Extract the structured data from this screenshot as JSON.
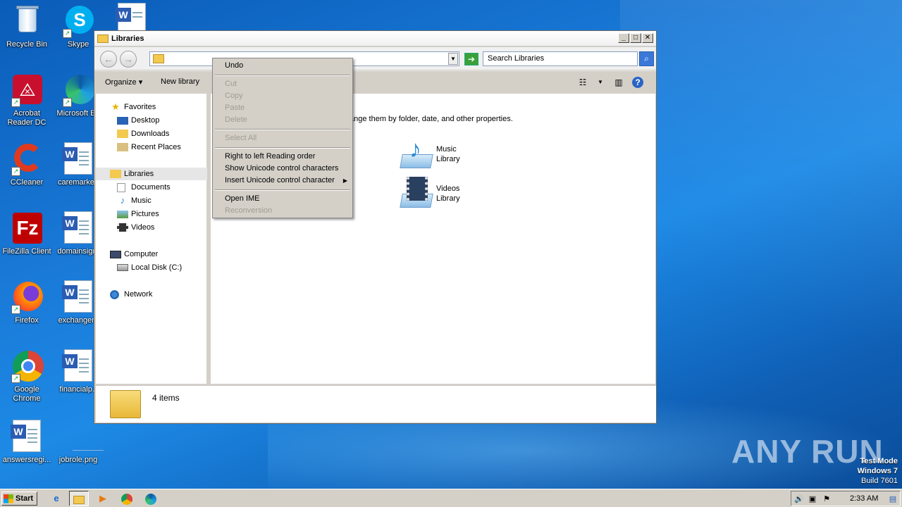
{
  "desktop": {
    "icons": [
      {
        "label": "Recycle Bin"
      },
      {
        "label": "Skype"
      },
      {
        "label": "Acrobat Reader DC"
      },
      {
        "label": "Microsoft Ed"
      },
      {
        "label": "CCleaner"
      },
      {
        "label": "caremarket."
      },
      {
        "label": "FileZilla Client"
      },
      {
        "label": "domainsign."
      },
      {
        "label": "Firefox"
      },
      {
        "label": "exchangem"
      },
      {
        "label": "Google Chrome"
      },
      {
        "label": "financialp.r"
      },
      {
        "label": "answersregi..."
      },
      {
        "label": "jobrole.png"
      }
    ],
    "watermark": "ANY RUN",
    "test_mode": [
      "Test Mode",
      "Windows 7",
      "Build 7601"
    ]
  },
  "window": {
    "title": "Libraries",
    "search_placeholder": "Search Libraries",
    "toolbar": {
      "organize": "Organize",
      "new_library": "New library"
    },
    "nav": {
      "favorites": "Favorites",
      "desktop": "Desktop",
      "downloads": "Downloads",
      "recent_places": "Recent Places",
      "libraries": "Libraries",
      "documents": "Documents",
      "music": "Music",
      "pictures": "Pictures",
      "videos": "Videos",
      "computer": "Computer",
      "local_disk": "Local Disk (C:)",
      "network": "Network"
    },
    "content": {
      "description": "ange them by folder, date, and other properties.",
      "music_library": [
        "Music",
        "Library"
      ],
      "videos_library": [
        "Videos",
        "Library"
      ]
    },
    "details": {
      "count": "4 items"
    }
  },
  "context_menu": {
    "undo": "Undo",
    "cut": "Cut",
    "copy": "Copy",
    "paste": "Paste",
    "delete": "Delete",
    "select_all": "Select All",
    "rtl": "Right to left Reading order",
    "show_unicode": "Show Unicode control characters",
    "insert_unicode": "Insert Unicode control character",
    "open_ime": "Open IME",
    "reconversion": "Reconversion"
  },
  "taskbar": {
    "start": "Start",
    "clock": "2:33 AM"
  }
}
